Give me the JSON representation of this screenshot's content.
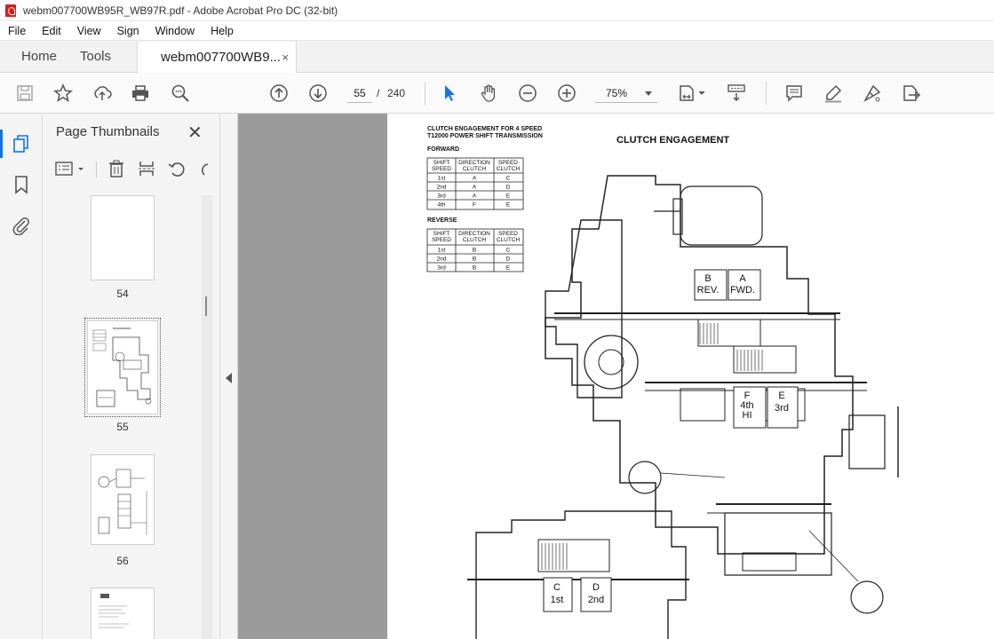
{
  "window": {
    "title": "webm007700WB95R_WB97R.pdf - Adobe Acrobat Pro DC (32-bit)"
  },
  "menu": [
    "File",
    "Edit",
    "View",
    "Sign",
    "Window",
    "Help"
  ],
  "tabs": {
    "home": "Home",
    "tools": "Tools",
    "document": "webm007700WB9...",
    "close_glyph": "×"
  },
  "toolbar": {
    "current_page": "55",
    "separator": "/",
    "total_pages": "240",
    "zoom": "75%",
    "icons": [
      "save-icon",
      "star-icon",
      "upload-icon",
      "print-icon",
      "search-zoom-icon",
      "page-up-icon",
      "page-down-icon",
      "select-arrow-icon",
      "hand-icon",
      "zoom-out-icon",
      "zoom-in-icon",
      "fit-page-icon",
      "scroll-mode-icon",
      "comment-icon",
      "highlight-icon",
      "sign-icon",
      "export-icon"
    ]
  },
  "sidebar": {
    "title": "Page Thumbnails",
    "close_glyph": "✕",
    "thumbnails": [
      {
        "label": "54"
      },
      {
        "label": "55"
      },
      {
        "label": "56"
      }
    ]
  },
  "page": {
    "header_line1": "CLUTCH ENGAGEMENT FOR 4 SPEED",
    "header_line2": "T12000 POWER SHIFT TRANSMISSION",
    "title": "CLUTCH ENGAGEMENT",
    "forward_label": "FORWARD",
    "reverse_label": "REVERSE",
    "table_headers": [
      "SHIFT SPEED",
      "DIRECTION CLUTCH",
      "SPEED CLUTCH"
    ],
    "forward_rows": [
      [
        "1st",
        "A",
        "C"
      ],
      [
        "2nd",
        "A",
        "D"
      ],
      [
        "3rd",
        "A",
        "E"
      ],
      [
        "4th",
        "F",
        "E"
      ]
    ],
    "reverse_rows": [
      [
        "1st",
        "B",
        "C"
      ],
      [
        "2nd",
        "B",
        "D"
      ],
      [
        "3rd",
        "B",
        "E"
      ]
    ],
    "diagram_labels": {
      "b": "B",
      "rev": "REV.",
      "a": "A",
      "fwd": "FWD.",
      "f": "F",
      "fourth": "4th",
      "hi": "HI",
      "e": "E",
      "third": "3rd",
      "c": "C",
      "first": "1st",
      "d": "D",
      "second": "2nd"
    }
  }
}
